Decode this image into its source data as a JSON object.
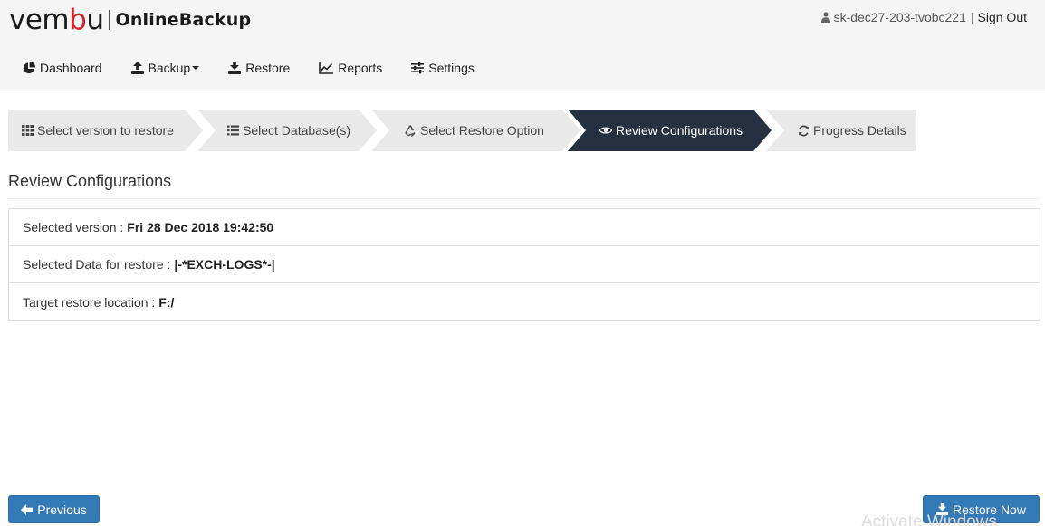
{
  "header": {
    "brand": {
      "prefix": "vem",
      "accent": "b",
      "suffix": "u"
    },
    "product": "OnlineBackup",
    "username": "sk-dec27-203-tvobc221",
    "separator": "|",
    "signout_label": "Sign Out"
  },
  "nav": {
    "items": [
      {
        "label": "Dashboard",
        "icon": "pie-chart-icon"
      },
      {
        "label": "Backup",
        "icon": "upload-icon",
        "has_dropdown": true
      },
      {
        "label": "Restore",
        "icon": "download-icon"
      },
      {
        "label": "Reports",
        "icon": "line-chart-icon"
      },
      {
        "label": "Settings",
        "icon": "sliders-icon"
      }
    ]
  },
  "wizard": {
    "active_index": 3,
    "steps": [
      {
        "label": "Select version to restore",
        "icon": "grid-icon"
      },
      {
        "label": "Select Database(s)",
        "icon": "list-icon"
      },
      {
        "label": "Select Restore Option",
        "icon": "recycle-icon"
      },
      {
        "label": "Review Configurations",
        "icon": "eye-icon"
      },
      {
        "label": "Progress Details",
        "icon": "refresh-icon"
      }
    ]
  },
  "review": {
    "title": "Review Configurations",
    "rows": [
      {
        "label": "Selected version :",
        "value": "Fri 28 Dec 2018 19:42:50"
      },
      {
        "label": "Selected Data for restore :",
        "value": "|-*EXCH-LOGS*-|"
      },
      {
        "label": "Target restore location :",
        "value": "F:/"
      }
    ]
  },
  "footer": {
    "previous_label": "Previous",
    "restore_label": "Restore Now"
  },
  "watermark": "Activate Windows",
  "colors": {
    "brand_red": "#d42027",
    "active_step": "#253141",
    "primary_button": "#337ab7",
    "header_bg": "#f5f5f5"
  }
}
